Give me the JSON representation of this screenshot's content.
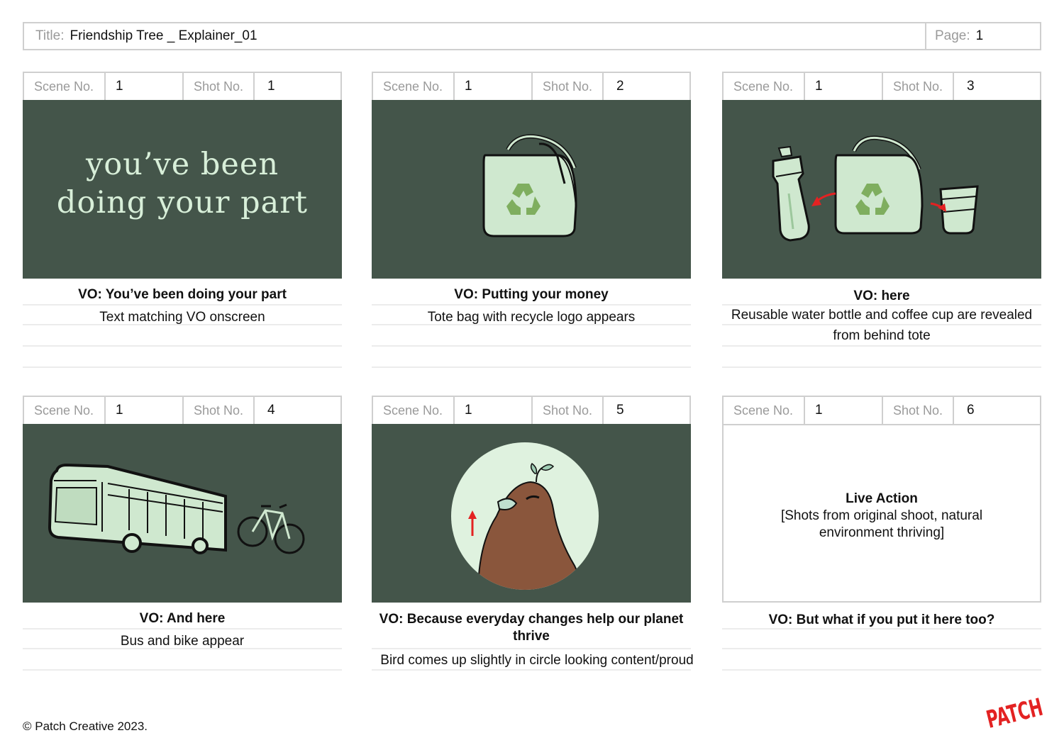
{
  "header": {
    "title_label": "Title:",
    "title_value": "Friendship Tree _ Explainer_01",
    "page_label": "Page:",
    "page_value": "1"
  },
  "labels": {
    "scene": "Scene No.",
    "shot": "Shot No."
  },
  "panels": [
    {
      "scene": "1",
      "shot": "1",
      "vo": "VO: You’ve been doing your part",
      "desc": "Text matching VO onscreen",
      "frame_text": [
        "you’ve been",
        "doing your part"
      ]
    },
    {
      "scene": "1",
      "shot": "2",
      "vo": "VO: Putting your money",
      "desc": "Tote bag with recycle logo appears"
    },
    {
      "scene": "1",
      "shot": "3",
      "vo": "VO: here",
      "desc": "Reusable water bottle and coffee cup are revealed from behind tote"
    },
    {
      "scene": "1",
      "shot": "4",
      "vo": "VO: And here",
      "desc": "Bus and bike appear"
    },
    {
      "scene": "1",
      "shot": "5",
      "vo": "VO: Because everyday changes help our planet thrive",
      "desc": "Bird comes up slightly in circle looking content/proud"
    },
    {
      "scene": "1",
      "shot": "6",
      "vo": "VO: But what if you put it here too?",
      "desc": "",
      "live_action_title": "Live Action",
      "live_action_desc": "[Shots from original shoot, natural environment thriving]"
    }
  ],
  "footer": {
    "copyright": "© Patch Creative 2023.",
    "logo": "PATCH"
  },
  "colors": {
    "frame_bg": "#44554a",
    "prop_green": "#cfe8cf",
    "logo_red": "#e32222",
    "bird_brown": "#8a563c"
  }
}
